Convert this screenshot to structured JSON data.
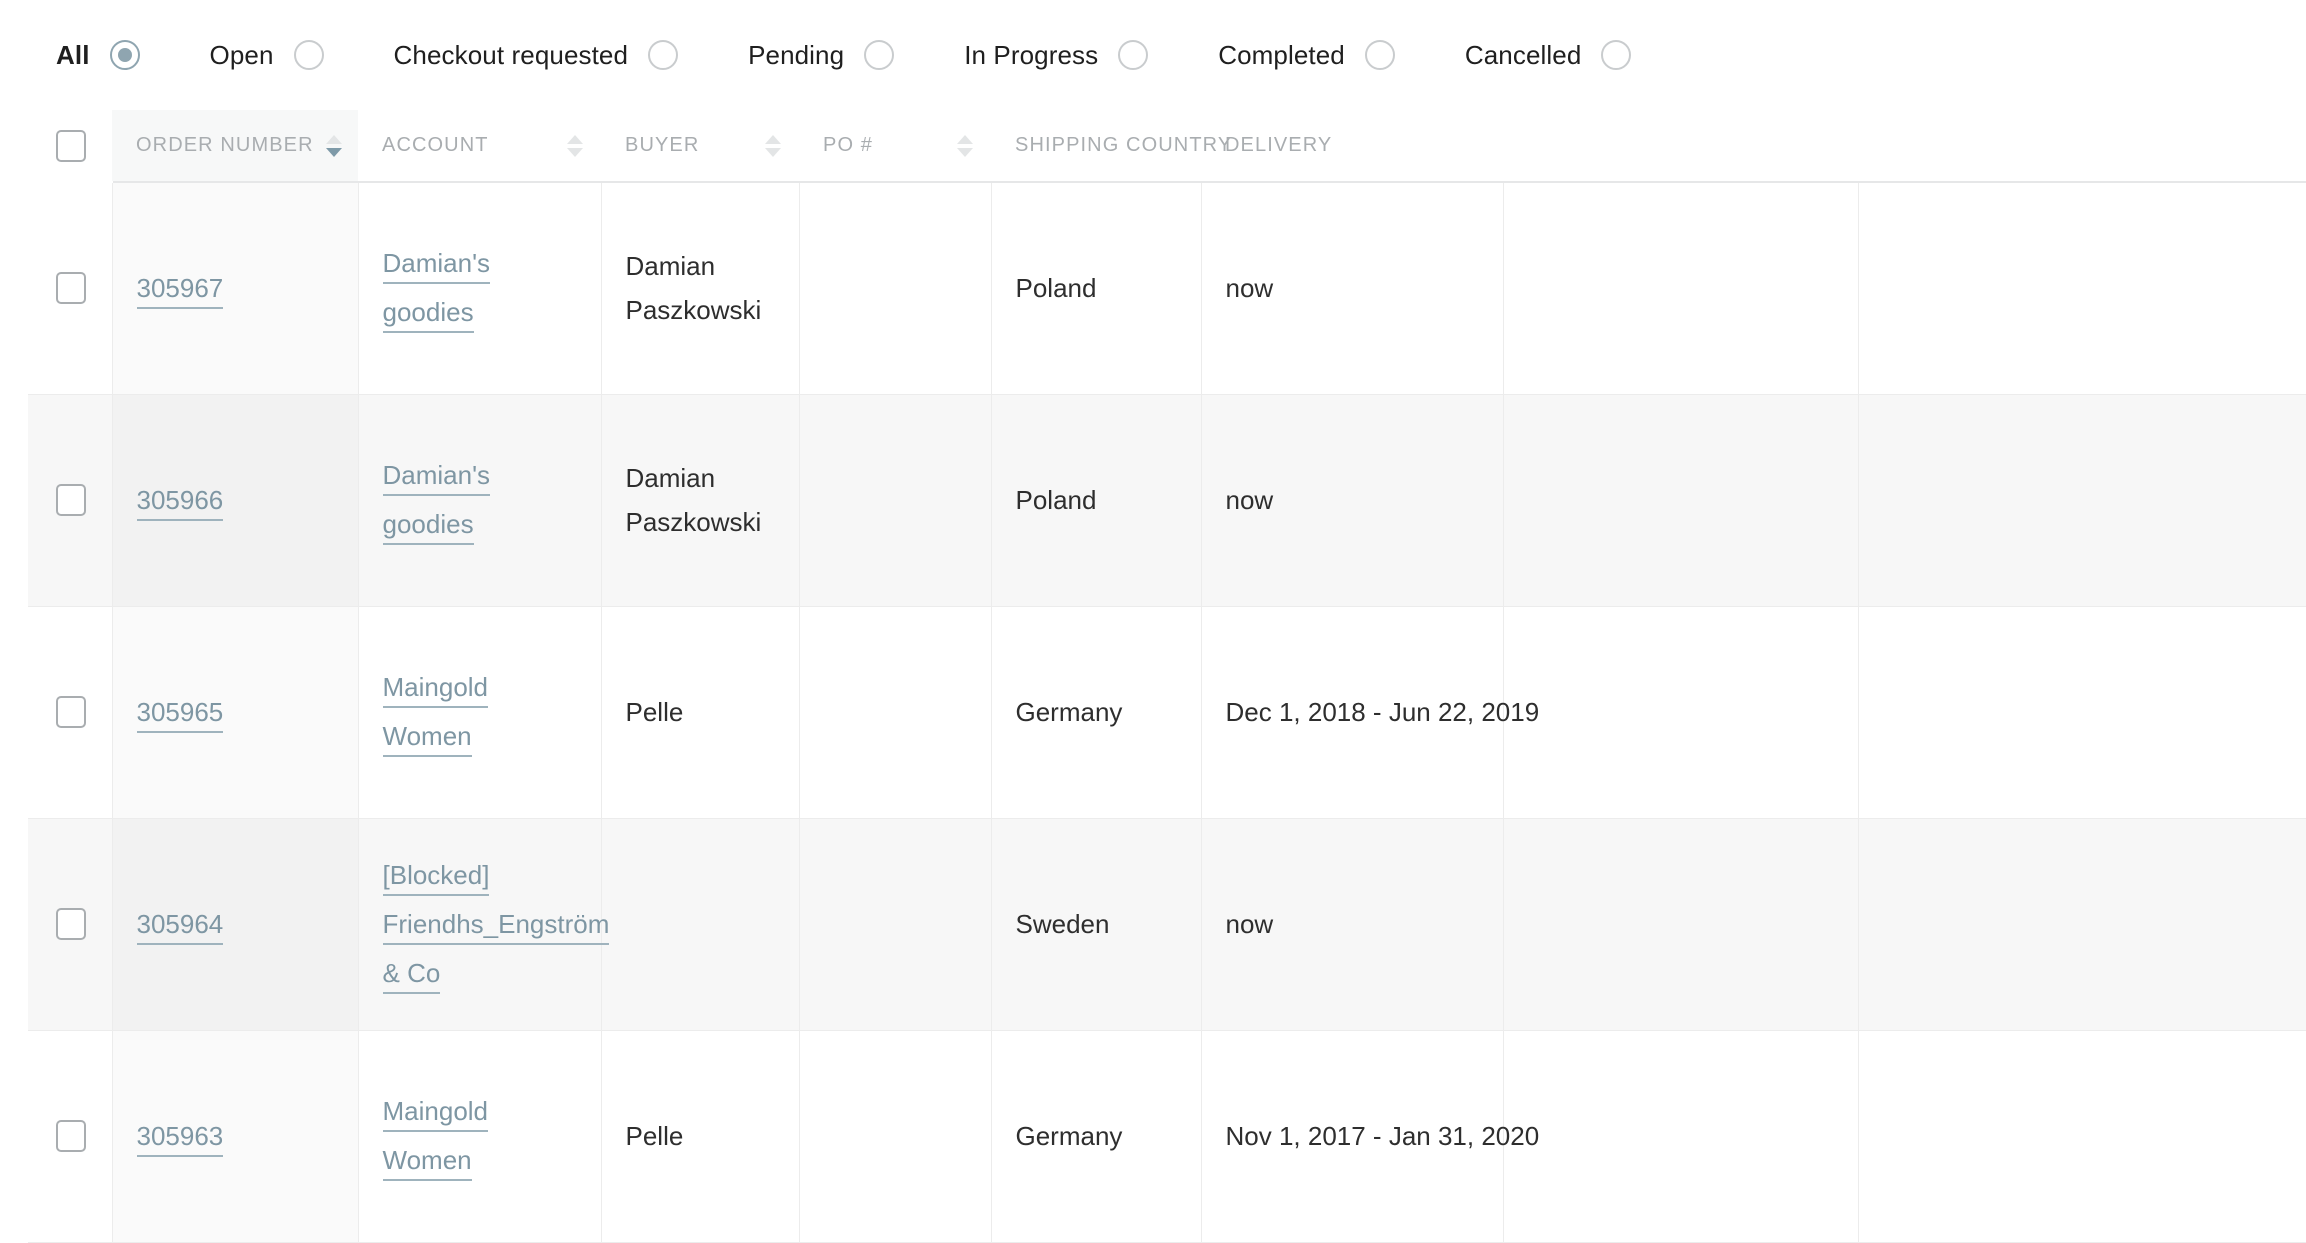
{
  "filters": {
    "items": [
      {
        "label": "All",
        "selected": true
      },
      {
        "label": "Open",
        "selected": false
      },
      {
        "label": "Checkout requested",
        "selected": false
      },
      {
        "label": "Pending",
        "selected": false
      },
      {
        "label": "In Progress",
        "selected": false
      },
      {
        "label": "Completed",
        "selected": false
      },
      {
        "label": "Cancelled",
        "selected": false
      }
    ]
  },
  "table": {
    "columns": [
      {
        "key": "check",
        "label": "",
        "sortable": false,
        "sort": "none"
      },
      {
        "key": "order",
        "label": "ORDER NUMBER",
        "sortable": true,
        "sort": "desc"
      },
      {
        "key": "account",
        "label": "ACCOUNT",
        "sortable": true,
        "sort": "none"
      },
      {
        "key": "buyer",
        "label": "BUYER",
        "sortable": true,
        "sort": "none"
      },
      {
        "key": "po",
        "label": "PO #",
        "sortable": true,
        "sort": "none"
      },
      {
        "key": "country",
        "label": "SHIPPING COUNTRY",
        "sortable": false,
        "sort": "none"
      },
      {
        "key": "delivery",
        "label": "DELIVERY",
        "sortable": false,
        "sort": "none"
      }
    ],
    "rows": [
      {
        "order_number": "305967",
        "account": "Damian's goodies",
        "buyer": "Damian Paszkowski",
        "po": "",
        "shipping_country": "Poland",
        "delivery": "now"
      },
      {
        "order_number": "305966",
        "account": "Damian's goodies",
        "buyer": "Damian Paszkowski",
        "po": "",
        "shipping_country": "Poland",
        "delivery": "now"
      },
      {
        "order_number": "305965",
        "account": "Maingold Women",
        "buyer": "Pelle",
        "po": "",
        "shipping_country": "Germany",
        "delivery": "Dec 1, 2018 - Jun 22, 2019"
      },
      {
        "order_number": "305964",
        "account": "[Blocked] Friendhs_Engström & Co",
        "buyer": "",
        "po": "",
        "shipping_country": "Sweden",
        "delivery": "now"
      },
      {
        "order_number": "305963",
        "account": "Maingold Women",
        "buyer": "Pelle",
        "po": "",
        "shipping_country": "Germany",
        "delivery": "Nov 1, 2017 - Jan 31, 2020"
      }
    ]
  },
  "colors": {
    "link": "#7e96a3",
    "radio_selected": "#8fa5b0",
    "sort_active": "#7e9aa8",
    "header_text": "#a9adb0",
    "body_text": "#2e2e2e",
    "row_alt_bg": "#f7f7f7",
    "sorted_column_bg": "#fafafa"
  }
}
